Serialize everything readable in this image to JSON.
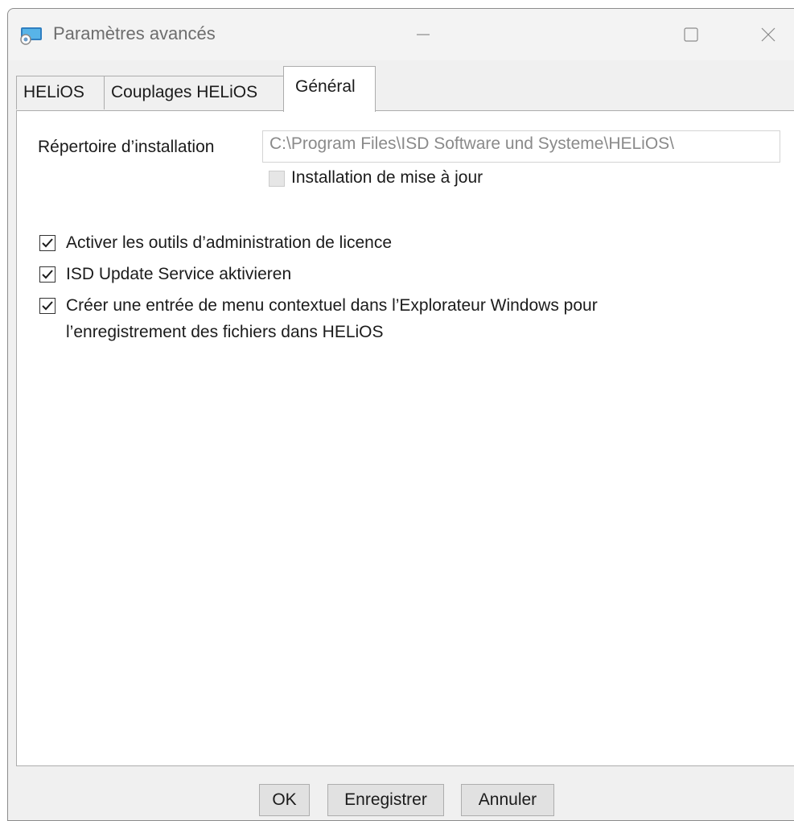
{
  "window": {
    "title": "Paramètres avancés",
    "icon": "app-icon",
    "controls": [
      "minimize-icon",
      "maximize-icon",
      "close-icon"
    ]
  },
  "tabs": [
    {
      "label": "HELiOS",
      "selected": false
    },
    {
      "label": "Couplages HELiOS",
      "selected": false
    },
    {
      "label": "Général",
      "selected": true
    }
  ],
  "general": {
    "install_dir_label": "Répertoire d’installation",
    "install_dir_value": "C:\\Program Files\\ISD Software und Systeme\\HELiOS\\",
    "update_install": {
      "label": "Installation de mise à jour",
      "checked": false,
      "enabled": false
    },
    "options": [
      {
        "label": "Activer les outils d’administration de licence",
        "checked": true
      },
      {
        "label": "ISD Update Service aktivieren",
        "checked": true
      },
      {
        "label_line1": "Créer une entrée de menu contextuel dans l’Explorateur Windows pour",
        "label_line2": "l’enregistrement des fichiers dans HELiOS",
        "checked": true
      }
    ]
  },
  "buttons": {
    "ok": "OK",
    "save": "Enregistrer",
    "cancel": "Annuler"
  }
}
